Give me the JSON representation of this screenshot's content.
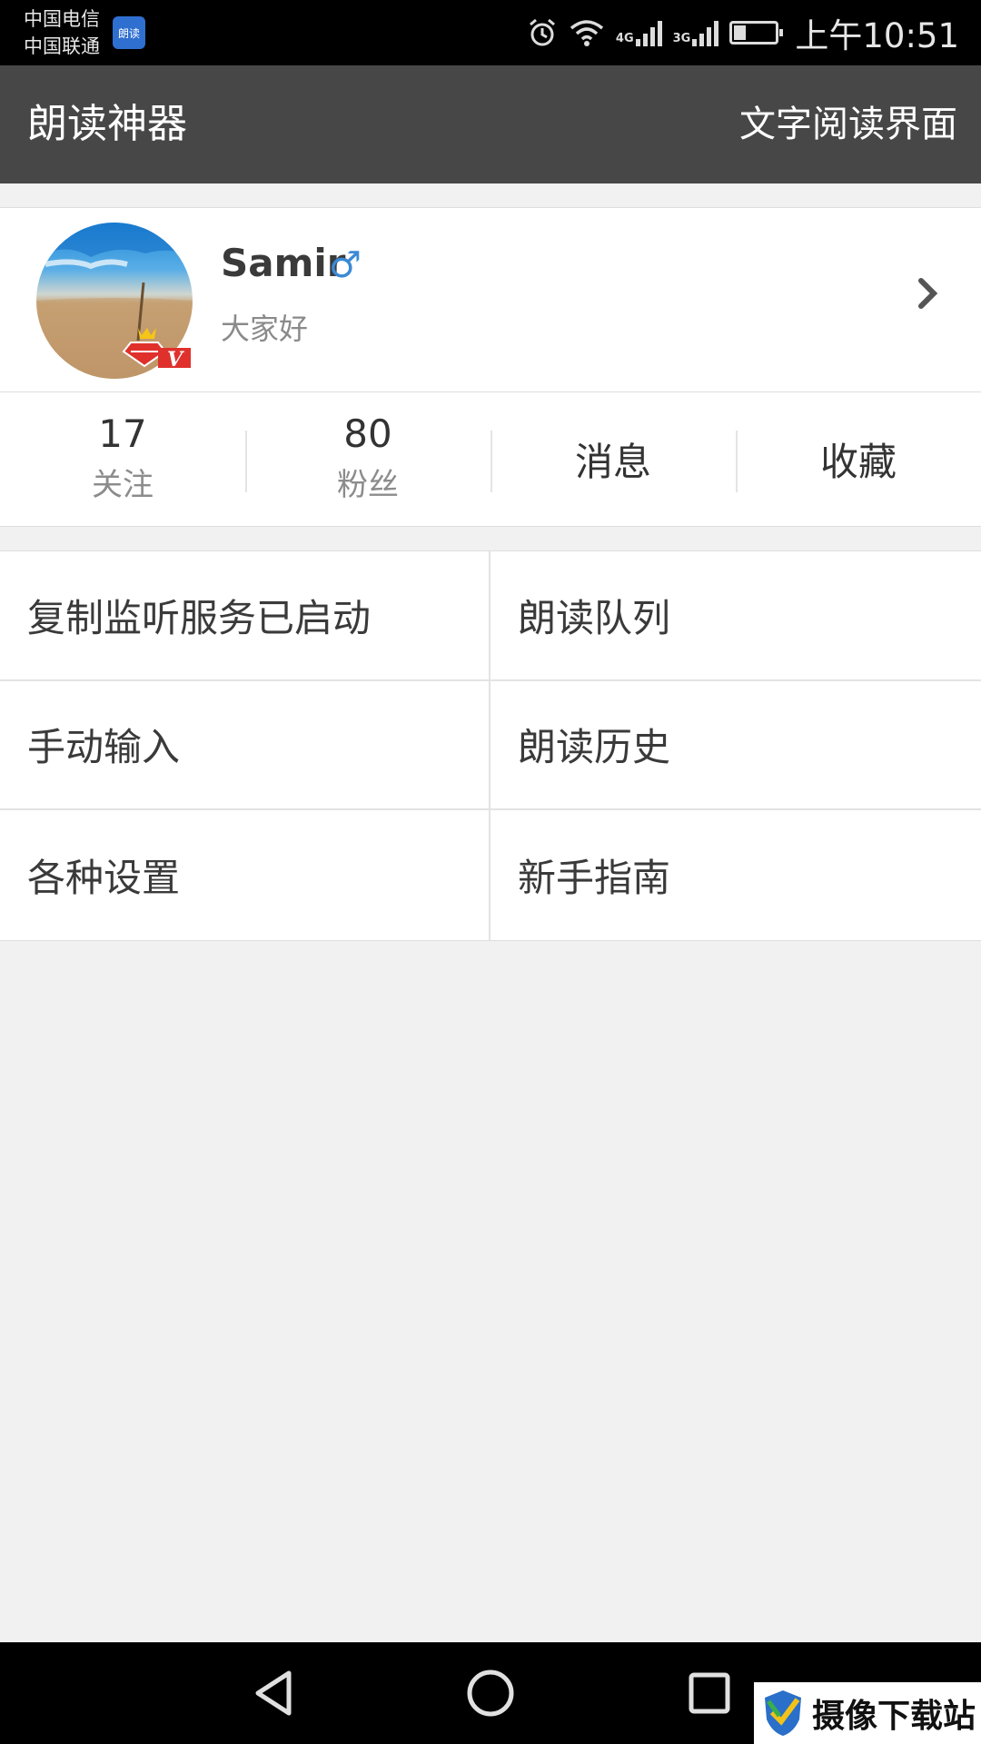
{
  "status_bar": {
    "carrier_1": "中国电信",
    "carrier_2": "中国联通",
    "app_badge": "朗读",
    "net_4g": "4G",
    "net_3g": "3G",
    "battery_level": 0.3,
    "time": "上午10:51"
  },
  "app_bar": {
    "title": "朗读神器",
    "action": "文字阅读界面"
  },
  "profile": {
    "name": "Samir",
    "gender_symbol": "♂",
    "signature": "大家好",
    "vip_label": "V"
  },
  "stats": {
    "following_count": "17",
    "following_label": "关注",
    "fans_count": "80",
    "fans_label": "粉丝",
    "messages_label": "消息",
    "favorites_label": "收藏"
  },
  "menu": {
    "copy_monitor": "复制监听服务已启动",
    "read_queue": "朗读队列",
    "manual_input": "手动输入",
    "read_history": "朗读历史",
    "settings": "各种设置",
    "guide": "新手指南"
  },
  "watermark": {
    "text": "摄像下载站"
  },
  "colors": {
    "app_bar_bg": "#474747",
    "status_bar_bg": "#000000",
    "page_bg": "#f1f1f1",
    "gender_blue": "#3b8ad6",
    "vip_red": "#e0302c"
  }
}
